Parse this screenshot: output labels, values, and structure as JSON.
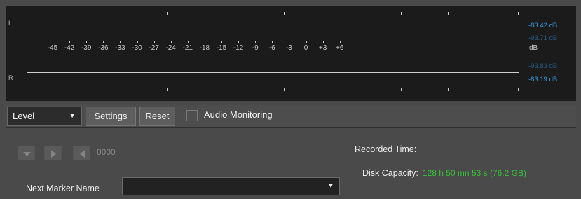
{
  "meter": {
    "channel_left": "L",
    "channel_right": "R",
    "scale_labels": [
      "-45",
      "-42",
      "-39",
      "-36",
      "-33",
      "-30",
      "-27",
      "-24",
      "-21",
      "-18",
      "-15",
      "-12",
      "-9",
      "-6",
      "-3",
      "0",
      "+3",
      "+6"
    ],
    "scale_unit": "dB",
    "left_rms": "-83.42 dB",
    "left_peak": "-93.71 dB",
    "right_peak": "-93.83 dB",
    "right_rms": "-83.19 dB",
    "rms_color": "#3aa0e6",
    "peak_color": "#275c86"
  },
  "toolbar": {
    "level_select": "Level",
    "settings_label": "Settings",
    "reset_label": "Reset",
    "audio_monitoring_label": "Audio Monitoring",
    "audio_monitoring_checked": false
  },
  "transport": {
    "icons": [
      "marker-down-icon",
      "play-icon",
      "back-icon"
    ],
    "counter": "0000"
  },
  "recording": {
    "recorded_time_label": "Recorded Time:",
    "disk_capacity_label": "Disk Capacity:",
    "disk_capacity_value": "128 h 50 mn 53 s (76.2 GB)",
    "disk_capacity_color": "#34c23a"
  },
  "marker": {
    "next_marker_label": "Next Marker Name",
    "next_marker_value": ""
  }
}
